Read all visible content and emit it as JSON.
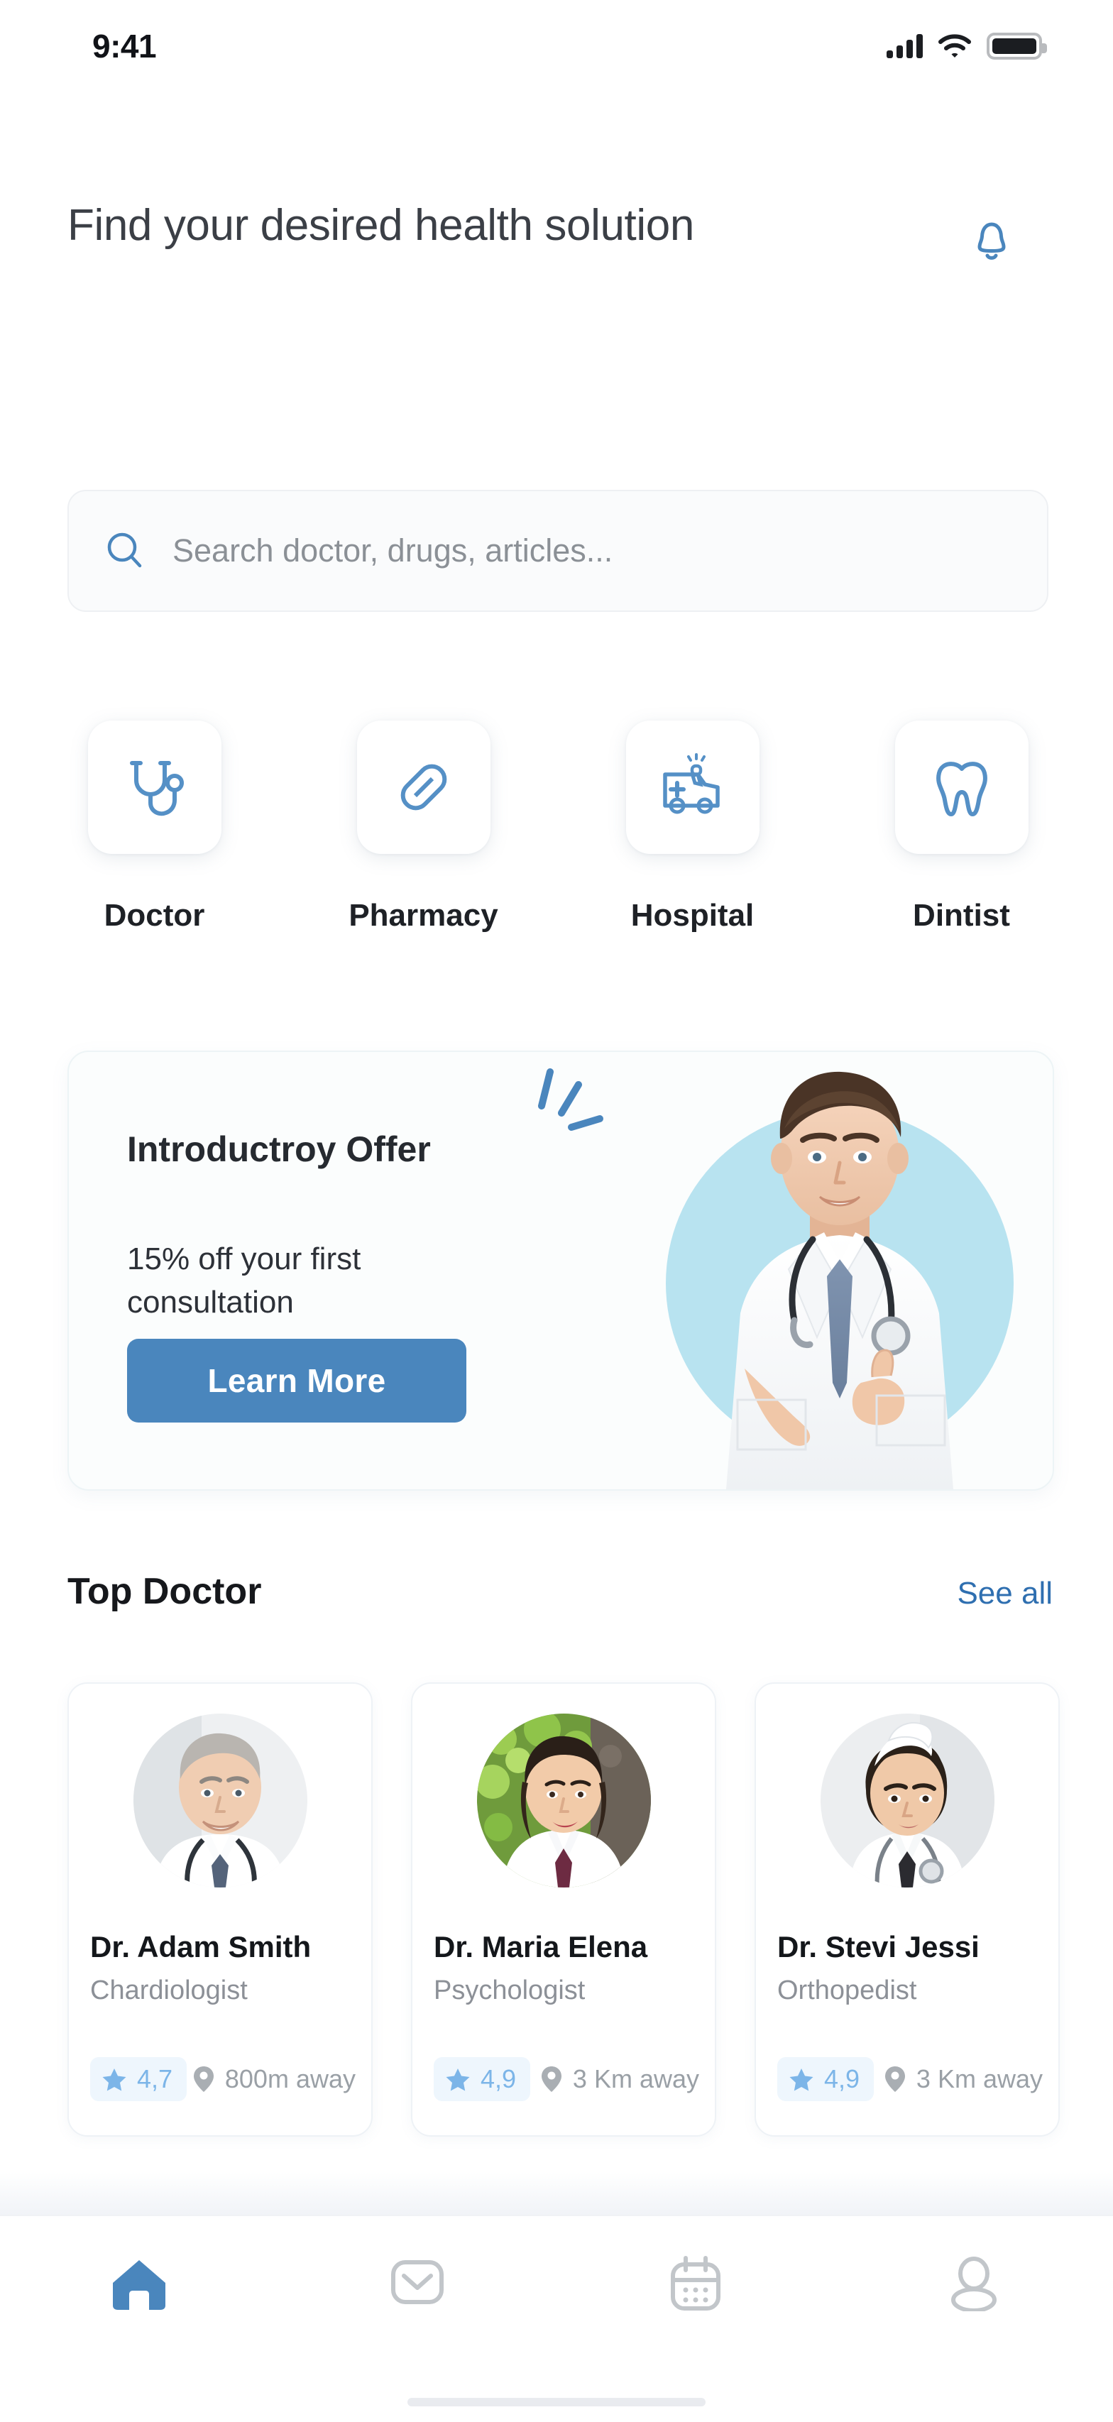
{
  "status_bar": {
    "time": "9:41",
    "signal_icon": "cellular-signal-icon",
    "wifi_icon": "wifi-icon",
    "battery_icon": "battery-full-icon"
  },
  "header": {
    "title": "Find your desired health solution",
    "notification_icon": "bell-icon"
  },
  "search": {
    "placeholder": "Search doctor, drugs, articles...",
    "value": "",
    "icon": "search-icon"
  },
  "categories": [
    {
      "label": "Doctor",
      "icon": "stethoscope-icon"
    },
    {
      "label": "Pharmacy",
      "icon": "pill-capsule-icon"
    },
    {
      "label": "Hospital",
      "icon": "ambulance-icon"
    },
    {
      "label": "Dintist",
      "icon": "tooth-icon"
    }
  ],
  "promo": {
    "title": "Introductroy Offer",
    "subtitle": "15% off your first consultation",
    "button_label": "Learn More",
    "sparkle_icon": "sparkle-burst-icon",
    "photo_alt": "smiling-male-doctor-thumbs-up"
  },
  "top_doctor": {
    "section_title": "Top Doctor",
    "see_all_label": "See all",
    "doctors": [
      {
        "name": "Dr. Adam Smith",
        "specialty": "Chardiologist",
        "rating": "4,7",
        "distance": "800m away",
        "avatar_alt": "older-male-doctor-photo",
        "star_icon": "star-icon",
        "pin_icon": "location-pin-icon"
      },
      {
        "name": "Dr. Maria Elena",
        "specialty": "Psychologist",
        "rating": "4,9",
        "distance": "3 Km away",
        "avatar_alt": "female-doctor-outdoor-photo",
        "star_icon": "star-icon",
        "pin_icon": "location-pin-icon"
      },
      {
        "name": "Dr. Stevi Jessi",
        "specialty": "Orthopedist",
        "rating": "4,9",
        "distance": "3 Km away",
        "avatar_alt": "young-female-doctor-cap-photo",
        "star_icon": "star-icon",
        "pin_icon": "location-pin-icon"
      }
    ]
  },
  "bottom_nav": [
    {
      "icon": "home-icon",
      "active": true
    },
    {
      "icon": "envelope-icon",
      "active": false
    },
    {
      "icon": "calendar-icon",
      "active": false
    },
    {
      "icon": "person-icon",
      "active": false
    }
  ],
  "colors": {
    "accent_blue": "#4a86bd",
    "icon_blue": "#5590c6",
    "rating_blue": "#7cb5e8",
    "rating_badge_bg": "#eef6fd",
    "link_blue": "#2f6fb0",
    "promo_circle": "#b8e3f0",
    "muted_gray": "#9aa0a6",
    "nav_inactive": "#c2c6ca"
  }
}
